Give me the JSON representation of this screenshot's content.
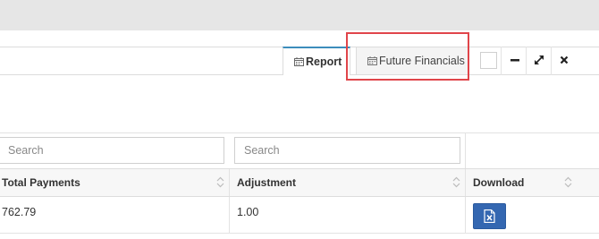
{
  "panel": {
    "tabs": [
      {
        "label": "Report",
        "icon": "calendar-icon",
        "active": true
      },
      {
        "label": "Future Financials",
        "icon": "calendar-icon",
        "active": false
      }
    ],
    "controls": [
      "blank-box",
      "minimize-icon",
      "maximize-icon",
      "close-icon"
    ]
  },
  "filters": {
    "search_1_placeholder": "Search",
    "search_2_placeholder": "Search"
  },
  "table": {
    "columns": [
      "Total Payments",
      "Adjustment",
      "Download"
    ],
    "rows": [
      {
        "total_payments": "762.79",
        "adjustment": "1.00",
        "download_icon": "excel-file-icon"
      }
    ]
  },
  "colors": {
    "highlight": "#e0454a",
    "tab_accent": "#3c8dbc",
    "download_button": "#3467b1"
  }
}
